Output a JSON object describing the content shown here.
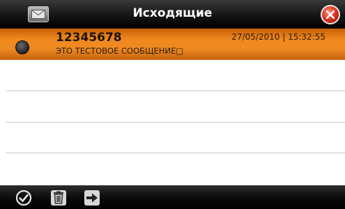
{
  "header": {
    "title": "Исходящие",
    "envelope_icon": "envelope-icon",
    "close_icon": "close-icon"
  },
  "messages": [
    {
      "sender": "12345678",
      "datetime": "27/05/2010 | 15:32:55",
      "preview": "ЭТО ТЕСТОВОЕ СООБЩЕНИЕ□",
      "selected": true
    }
  ],
  "toolbar": {
    "icons": [
      "check-icon",
      "trash-icon",
      "forward-arrow-icon"
    ]
  },
  "colors": {
    "selected_row": "#ef8a22",
    "title_bar": "#000000",
    "close_button": "#d62c1a"
  }
}
